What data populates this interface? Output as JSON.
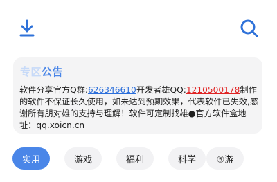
{
  "header": {
    "download_icon": "download-arrow-icon",
    "search_icon": "search-icon",
    "accent": "#2f72d9"
  },
  "notice": {
    "title_faded": "专区",
    "title": "公告",
    "text_1": "软件分享官方Q群:",
    "group_number": "626346610",
    "text_2": "开发者雄QQ:",
    "dev_qq": "1210500178",
    "text_3": "制作的软件不保证长久使用，如未达到预期效果，代表软件已失效,感谢所有朋对雄的支持与理解！软件可定制找雄●官方软件盒地址：qq.xoicn.cn",
    "accent": "#4a86e8",
    "link_color": "#2c6fdb",
    "qq_color": "#e02424"
  },
  "tabs": [
    {
      "label": "实用",
      "active": true
    },
    {
      "label": "游戏",
      "active": false
    },
    {
      "label": "福利",
      "active": false
    },
    {
      "label": "科学",
      "active": false
    },
    {
      "label": "⑤游",
      "active": false
    }
  ]
}
